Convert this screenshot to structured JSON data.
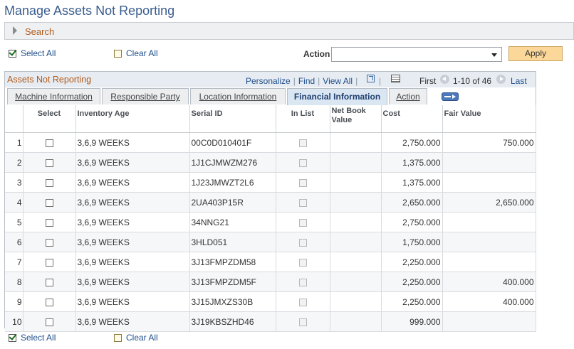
{
  "page": {
    "title": "Manage Assets Not Reporting"
  },
  "search": {
    "label": "Search"
  },
  "top_actions": {
    "select_all": "Select All",
    "clear_all": "Clear All"
  },
  "bottom_actions": {
    "select_all": "Select All",
    "clear_all": "Clear All"
  },
  "action": {
    "label": "Action",
    "value": "",
    "apply_label": "Apply"
  },
  "grid": {
    "title": "Assets Not Reporting",
    "personalize": "Personalize",
    "find": "Find",
    "view_all": "View All",
    "first": "First",
    "range": "1-10 of 46",
    "last": "Last",
    "tabs": [
      {
        "label": "Machine Information"
      },
      {
        "label": "Responsible Party"
      },
      {
        "label": "Location Information"
      },
      {
        "label": "Financial Information"
      },
      {
        "label": "Action"
      }
    ],
    "active_tab": "Financial Information",
    "columns": {
      "select": "Select",
      "inventory_age": "Inventory Age",
      "serial_id": "Serial ID",
      "in_list": "In List",
      "net_book_value": "Net Book Value",
      "cost": "Cost",
      "fair_value": "Fair Value"
    },
    "rows": [
      {
        "num": "1",
        "age": "3,6,9 WEEKS",
        "serial": "00C0D010401F",
        "nbv": "",
        "cost": "2,750.000",
        "fair": "750.000"
      },
      {
        "num": "2",
        "age": "3,6,9 WEEKS",
        "serial": "1J1CJMWZM276",
        "nbv": "",
        "cost": "1,375.000",
        "fair": ""
      },
      {
        "num": "3",
        "age": "3,6,9 WEEKS",
        "serial": "1J23JMWZT2L6",
        "nbv": "",
        "cost": "1,375.000",
        "fair": ""
      },
      {
        "num": "4",
        "age": "3,6,9 WEEKS",
        "serial": "2UA403P15R",
        "nbv": "",
        "cost": "2,650.000",
        "fair": "2,650.000"
      },
      {
        "num": "5",
        "age": "3,6,9 WEEKS",
        "serial": "34NNG21",
        "nbv": "",
        "cost": "2,750.000",
        "fair": ""
      },
      {
        "num": "6",
        "age": "3,6,9 WEEKS",
        "serial": "3HLD051",
        "nbv": "",
        "cost": "1,750.000",
        "fair": ""
      },
      {
        "num": "7",
        "age": "3,6,9 WEEKS",
        "serial": "3J13FMPZDM58",
        "nbv": "",
        "cost": "2,250.000",
        "fair": ""
      },
      {
        "num": "8",
        "age": "3,6,9 WEEKS",
        "serial": "3J13FMPZDM5F",
        "nbv": "",
        "cost": "2,250.000",
        "fair": "400.000"
      },
      {
        "num": "9",
        "age": "3,6,9 WEEKS",
        "serial": "3J15JMXZS30B",
        "nbv": "",
        "cost": "2,250.000",
        "fair": "400.000"
      },
      {
        "num": "10",
        "age": "3,6,9 WEEKS",
        "serial": "3J19KBSZHD46",
        "nbv": "",
        "cost": "999.000",
        "fair": ""
      }
    ]
  }
}
